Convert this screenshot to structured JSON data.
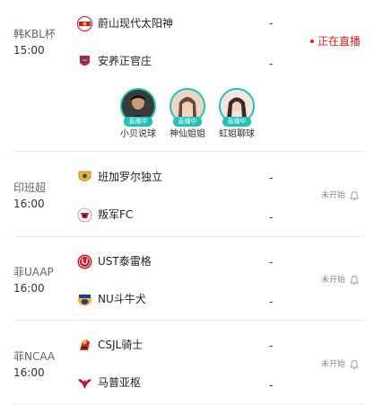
{
  "matches": [
    {
      "league": "韩KBL杯",
      "time": "15:00",
      "home": {
        "name": "蔚山现代太阳神",
        "score": "-",
        "logo": "ulsan-logo"
      },
      "away": {
        "name": "安养正官庄",
        "score": "-",
        "logo": "anyang-logo"
      },
      "status": "正在直播",
      "status_color": "#e02020",
      "streamers": [
        {
          "name": "小贝说球",
          "badge": "直播中"
        },
        {
          "name": "神仙姐姐",
          "badge": "直播中"
        },
        {
          "name": "虹姐聊球",
          "badge": "直播中"
        }
      ]
    },
    {
      "league": "印班超",
      "time": "16:00",
      "home": {
        "name": "班加罗尔独立",
        "score": "-",
        "logo": "bengaluru-logo"
      },
      "away": {
        "name": "叛军FC",
        "score": "-",
        "logo": "rebels-logo"
      },
      "status": "未开始"
    },
    {
      "league": "菲UAAP",
      "time": "16:00",
      "home": {
        "name": "UST泰雷格",
        "score": "-",
        "logo": "ust-logo"
      },
      "away": {
        "name": "NU斗牛犬",
        "score": "-",
        "logo": "nu-logo"
      },
      "status": "未开始"
    },
    {
      "league": "菲NCAA",
      "time": "16:00",
      "home": {
        "name": "CSJL骑士",
        "score": "-",
        "logo": "csjl-logo"
      },
      "away": {
        "name": "马普亚枢",
        "score": "-",
        "logo": "mapua-logo"
      },
      "status": "未开始"
    }
  ],
  "colors": {
    "live_red": "#e02020",
    "streamer_teal": "#1fc2b8",
    "divider": "#ececec"
  }
}
